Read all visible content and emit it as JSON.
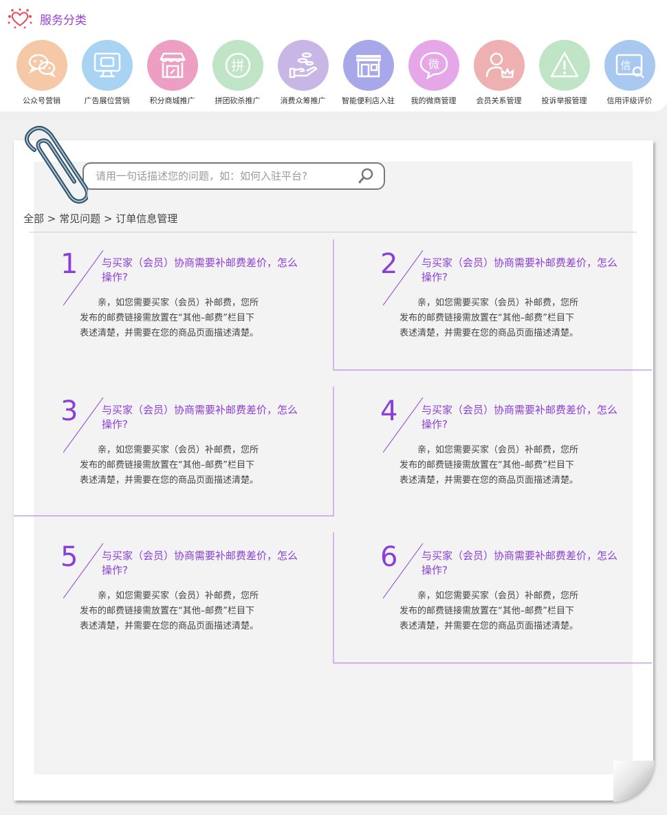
{
  "services": {
    "title": "服务分类",
    "items": [
      {
        "label": "公众号营销",
        "icon": "chat-bubbles-icon",
        "color": "#f5c9a7"
      },
      {
        "label": "广告展位营销",
        "icon": "monitor-icon",
        "color": "#a9d3f2"
      },
      {
        "label": "积分商城推广",
        "icon": "storefront-icon",
        "color": "#ec9fc3"
      },
      {
        "label": "拼团砍杀推广",
        "icon": "group-buy-icon",
        "color": "#bfe5c6"
      },
      {
        "label": "消费众筹推广",
        "icon": "coins-hand-icon",
        "color": "#c8b7e6"
      },
      {
        "label": "智能便利店入驻",
        "icon": "shop-icon",
        "color": "#a8a7ea"
      },
      {
        "label": "我的微商管理",
        "icon": "wei-icon",
        "color": "#e6a7e8"
      },
      {
        "label": "会员关系管理",
        "icon": "member-crown-icon",
        "color": "#eeb0b1"
      },
      {
        "label": "投诉举报管理",
        "icon": "warning-triangle-icon",
        "color": "#bfe5c6"
      },
      {
        "label": "信用评级评价",
        "icon": "credit-card-icon",
        "color": "#a9c8f0"
      }
    ]
  },
  "search": {
    "placeholder": "请用一句话描述您的问题，如：如何入驻平台?"
  },
  "breadcrumb": "全部 > 常见问题 > 订单信息管理",
  "faqs": [
    {
      "number": "1",
      "title": "与买家（会员）协商需要补邮费差价，怎么操作?",
      "body": "亲，如您需要买家（会员）补邮费，您所发布的邮费链接需放置在“其他–邮费”栏目下表述清楚，并需要在您的商品页面描述清楚。"
    },
    {
      "number": "2",
      "title": "与买家（会员）协商需要补邮费差价，怎么操作?",
      "body": "亲，如您需要买家（会员）补邮费，您所发布的邮费链接需放置在“其他–邮费”栏目下表述清楚，并需要在您的商品页面描述清楚。"
    },
    {
      "number": "3",
      "title": "与买家（会员）协商需要补邮费差价，怎么操作?",
      "body": "亲，如您需要买家（会员）补邮费，您所发布的邮费链接需放置在“其他–邮费”栏目下表述清楚，并需要在您的商品页面描述清楚。"
    },
    {
      "number": "4",
      "title": "与买家（会员）协商需要补邮费差价，怎么操作?",
      "body": "亲，如您需要买家（会员）补邮费，您所发布的邮费链接需放置在“其他–邮费”栏目下表述清楚，并需要在您的商品页面描述清楚。"
    },
    {
      "number": "5",
      "title": "与买家（会员）协商需要补邮费差价，怎么操作?",
      "body": "亲，如您需要买家（会员）补邮费，您所发布的邮费链接需放置在“其他–邮费”栏目下表述清楚，并需要在您的商品页面描述清楚。"
    },
    {
      "number": "6",
      "title": "与买家（会员）协商需要补邮费差价，怎么操作?",
      "body": "亲，如您需要买家（会员）补邮费，您所发布的邮费链接需放置在“其他–邮费”栏目下表述清楚，并需要在您的商品页面描述清楚。"
    }
  ],
  "colors": {
    "accent": "#8b3fd9",
    "brand_red": "#e84a5f"
  }
}
